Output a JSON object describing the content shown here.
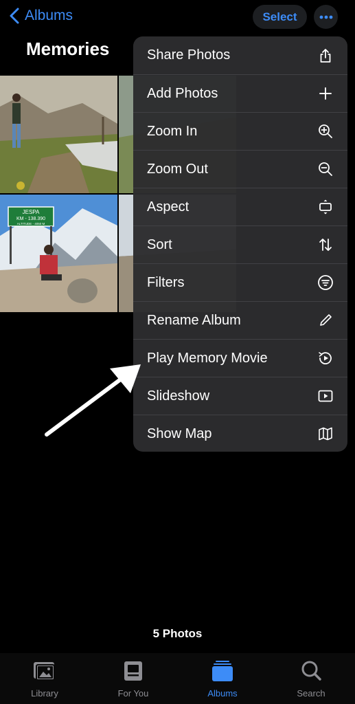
{
  "header": {
    "back_label": "Albums",
    "select_label": "Select",
    "title": "Memories"
  },
  "menu": {
    "items": [
      {
        "label": "Share Photos",
        "icon": "share-icon"
      },
      {
        "label": "Add Photos",
        "icon": "plus-icon"
      },
      {
        "label": "Zoom In",
        "icon": "zoom-in-icon"
      },
      {
        "label": "Zoom Out",
        "icon": "zoom-out-icon"
      },
      {
        "label": "Aspect",
        "icon": "aspect-icon"
      },
      {
        "label": "Sort",
        "icon": "sort-icon"
      },
      {
        "label": "Filters",
        "icon": "filter-icon"
      },
      {
        "label": "Rename Album",
        "icon": "pencil-icon"
      },
      {
        "label": "Play Memory Movie",
        "icon": "memory-movie-icon"
      },
      {
        "label": "Slideshow",
        "icon": "slideshow-icon"
      },
      {
        "label": "Show Map",
        "icon": "map-icon"
      }
    ]
  },
  "photos": {
    "sign_line1": "JESPA",
    "sign_line2": "KM - 138.390",
    "sign_line3": "ALTITUDE - 4050 M"
  },
  "footer": {
    "count": "5 Photos"
  },
  "tabbar": {
    "tabs": [
      {
        "label": "Library",
        "icon": "photo-library-icon"
      },
      {
        "label": "For You",
        "icon": "for-you-icon"
      },
      {
        "label": "Albums",
        "icon": "albums-icon",
        "active": true
      },
      {
        "label": "Search",
        "icon": "search-icon"
      }
    ]
  },
  "colors": {
    "accent": "#3d8cf7",
    "menu_bg": "#2c2c2e",
    "background": "#000000"
  }
}
